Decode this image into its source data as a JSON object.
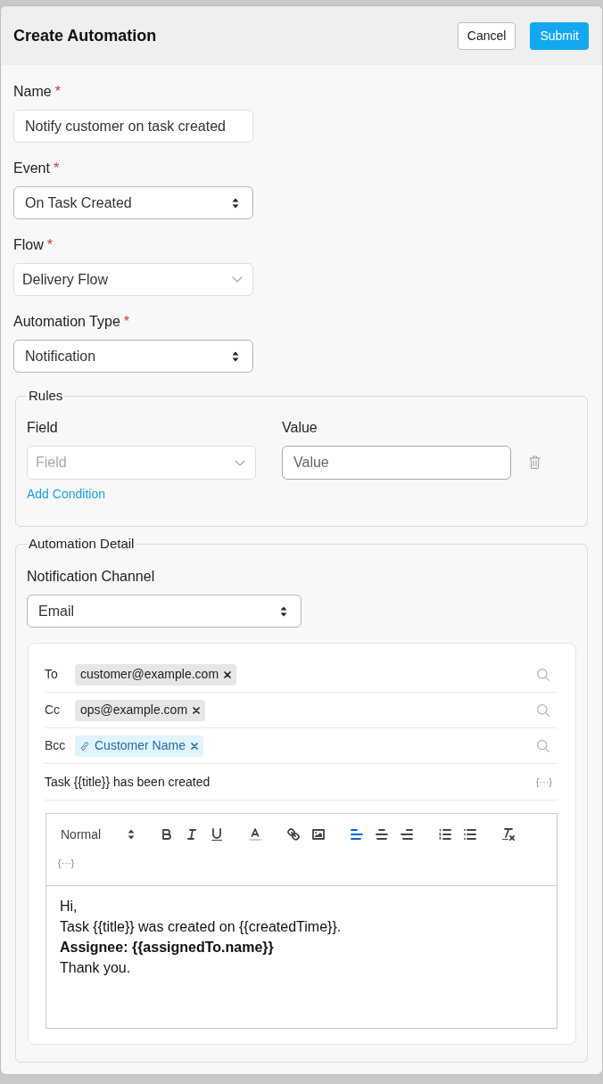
{
  "header": {
    "title": "Create Automation",
    "buttons": [
      {
        "label": "Cancel",
        "kind": "secondary"
      },
      {
        "label": "Submit",
        "kind": "primary"
      }
    ]
  },
  "fields": [
    {
      "label": "Name",
      "required_mark": "*",
      "kind": "input",
      "value": "Notify customer on task created"
    },
    {
      "label": "Event",
      "required_mark": "*",
      "kind": "select",
      "value": "On Task Created"
    },
    {
      "label": "Flow",
      "required_mark": "*",
      "kind": "dropdown",
      "value": "Delivery Flow"
    },
    {
      "label": "Automation Type",
      "required_mark": "*",
      "kind": "select",
      "value": "Notification"
    }
  ],
  "rules": {
    "legend": "Rules",
    "conditions": [
      {
        "field": {
          "label": "Field",
          "placeholder": "Field"
        },
        "value": {
          "label": "Value",
          "placeholder": "Value"
        }
      }
    ],
    "add_condition": "Add Condition"
  },
  "automation_detail": {
    "legend": "Automation Detail",
    "channel": {
      "label": "Notification Channel",
      "value": "Email"
    },
    "recipients": [
      {
        "label": "To",
        "chips": [
          {
            "text": "customer@example.com",
            "kind": "address"
          }
        ]
      },
      {
        "label": "Cc",
        "chips": [
          {
            "text": "ops@example.com",
            "kind": "address"
          }
        ]
      },
      {
        "label": "Bcc",
        "chips": [
          {
            "text": "Customer Name",
            "kind": "variable"
          }
        ]
      }
    ],
    "subject": {
      "value": "Task {{title}} has been created",
      "variable_button": "{···}"
    },
    "editor": {
      "format": "Normal",
      "alignment": [
        {
          "selected": true
        },
        {
          "selected": false
        },
        {
          "selected": false
        }
      ],
      "variable_button": "{···}",
      "lines": [
        {
          "text": "Hi,",
          "bold": false
        },
        {
          "text": "Task {{title}} was created on {{createdTime}}.",
          "bold": false
        },
        {
          "text": "Assignee: {{assignedTo.name}}",
          "bold": true
        },
        {
          "text": "Thank you.",
          "bold": false
        }
      ]
    }
  }
}
